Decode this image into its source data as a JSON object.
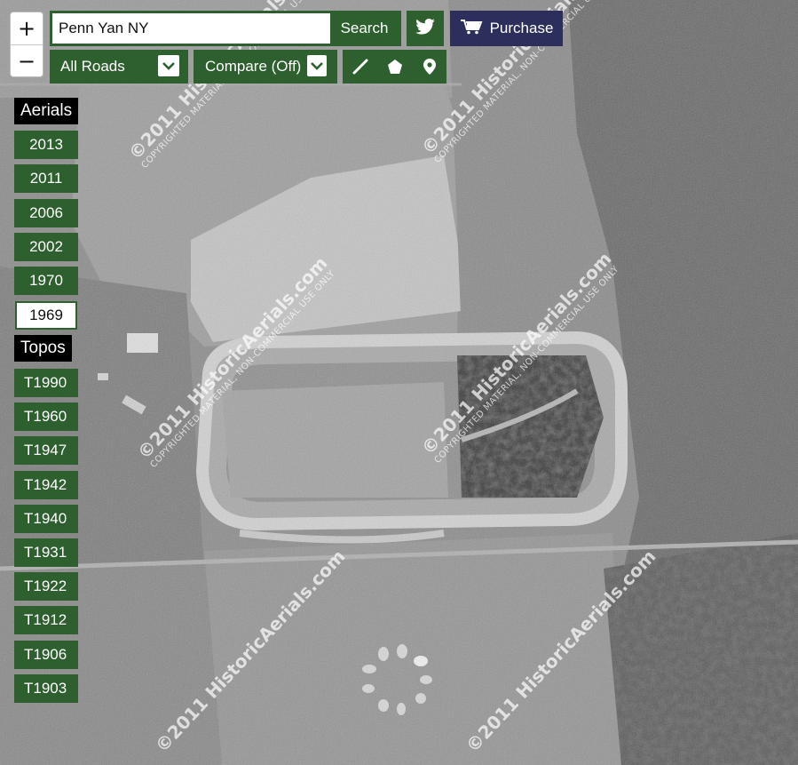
{
  "search": {
    "value": "Penn Yan NY",
    "button": "Search"
  },
  "zoom": {
    "in": "+",
    "out": "−"
  },
  "purchase": {
    "label": "Purchase"
  },
  "road_select": {
    "value": "All Roads"
  },
  "compare_select": {
    "value": "Compare (Off)"
  },
  "aerials": {
    "header": "Aerials",
    "years": [
      "2013",
      "2011",
      "2006",
      "2002",
      "1970",
      "1969"
    ],
    "selected": "1969"
  },
  "topos": {
    "header": "Topos",
    "years": [
      "T1990",
      "T1960",
      "T1947",
      "T1942",
      "T1940",
      "T1931",
      "T1922",
      "T1912",
      "T1906",
      "T1903"
    ]
  },
  "watermark": {
    "line1": "©2011 HistoricAerials.com",
    "line2": "Copyrighted material, non-commercial use only"
  },
  "icons": {
    "twitter": "twitter-icon",
    "cart": "cart-icon",
    "line": "draw-line-icon",
    "polygon": "draw-polygon-icon",
    "marker": "map-marker-icon",
    "chevron": "chevron-down-icon"
  },
  "colors": {
    "button_green": "#2d5f2f",
    "purchase_navy": "#2c2f5b",
    "header_black": "#000000"
  }
}
